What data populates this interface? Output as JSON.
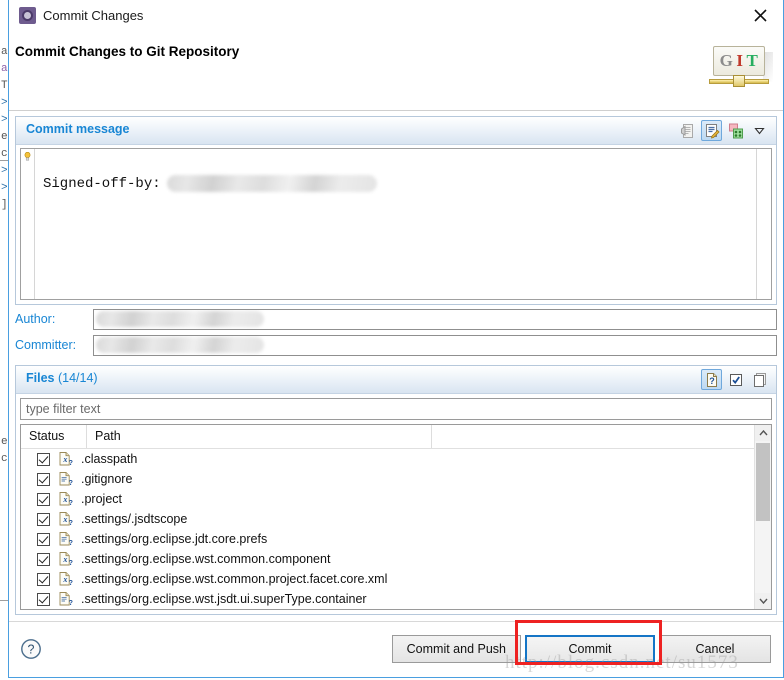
{
  "window": {
    "title": "Commit Changes",
    "title_icon": "gear-icon",
    "close_icon": "close-icon"
  },
  "header": {
    "title": "Commit Changes to Git Repository",
    "logo": {
      "g": "G",
      "i": "I",
      "t": "T"
    }
  },
  "commit_message_section": {
    "title": "Commit message",
    "message_prefix": "Signed-off-by:",
    "message_redacted": true,
    "tools": [
      {
        "name": "amend-commit-icon",
        "state": "disabled"
      },
      {
        "name": "signed-off-by-icon",
        "state": "active"
      },
      {
        "name": "add-change-id-icon",
        "state": "normal"
      },
      {
        "name": "chevron-down-icon",
        "state": "normal"
      }
    ]
  },
  "author_field": {
    "label": "Author:",
    "value": "",
    "redacted": true
  },
  "committer_field": {
    "label": "Committer:",
    "value": "",
    "redacted": true
  },
  "files_section": {
    "title": "Files",
    "count": "(14/14)",
    "tools": [
      {
        "name": "show-untracked-files-icon",
        "state": "active"
      },
      {
        "name": "select-all-icon",
        "state": "normal"
      },
      {
        "name": "deselect-all-icon",
        "state": "normal"
      }
    ],
    "filter": {
      "placeholder": "type filter text",
      "value": ""
    },
    "columns": [
      "Status",
      "Path"
    ],
    "rows": [
      {
        "checked": true,
        "icon": "xml-file-icon",
        "path": ".classpath"
      },
      {
        "checked": true,
        "icon": "text-file-icon",
        "path": ".gitignore"
      },
      {
        "checked": true,
        "icon": "xml-file-icon",
        "path": ".project"
      },
      {
        "checked": true,
        "icon": "xml-file-icon",
        "path": ".settings/.jsdtscope"
      },
      {
        "checked": true,
        "icon": "text-file-icon",
        "path": ".settings/org.eclipse.jdt.core.prefs"
      },
      {
        "checked": true,
        "icon": "xml-file-icon",
        "path": ".settings/org.eclipse.wst.common.component"
      },
      {
        "checked": true,
        "icon": "xml-file-icon",
        "path": ".settings/org.eclipse.wst.common.project.facet.core.xml"
      },
      {
        "checked": true,
        "icon": "text-file-icon",
        "path": ".settings/org.eclipse.wst.jsdt.ui.superType.container"
      }
    ]
  },
  "footer": {
    "help_icon": "help-circle-icon",
    "buttons": [
      {
        "name": "commit-and-push-button",
        "label": "Commit and Push",
        "default": false
      },
      {
        "name": "commit-button",
        "label": "Commit",
        "default": true
      },
      {
        "name": "cancel-button",
        "label": "Cancel",
        "default": false
      }
    ]
  },
  "annotation": {
    "color": "#ee2222",
    "target": "commit-button"
  },
  "watermark": {
    "text": "http://blog.csdn.net/su1573"
  },
  "background_editor": {
    "lines": [
      "a",
      "a",
      "T",
      ">",
      ">",
      "e",
      "c",
      ">",
      ">",
      "]",
      "e",
      "c"
    ]
  }
}
